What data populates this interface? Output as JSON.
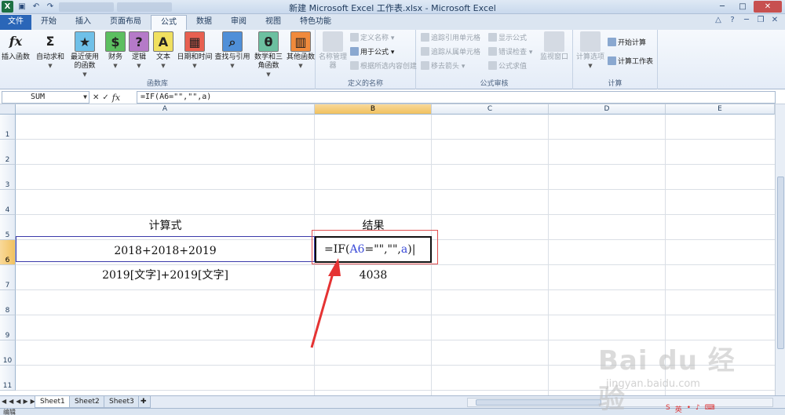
{
  "window": {
    "title": "新建 Microsoft Excel 工作表.xlsx - Microsoft Excel",
    "minimize": "─",
    "maximize": "□",
    "close": "✕"
  },
  "tabs": [
    "文件",
    "开始",
    "插入",
    "页面布局",
    "公式",
    "数据",
    "审阅",
    "视图",
    "特色功能"
  ],
  "active_tab": "公式",
  "ribbon": {
    "function_library": {
      "label": "函数库",
      "insert_function": "插入函数",
      "autosum": "自动求和",
      "recent": "最近使用的函数",
      "financial": "财务",
      "logical": "逻辑",
      "text": "文本",
      "datetime": "日期和时间",
      "lookup": "查找与引用",
      "math": "数学和三角函数",
      "more": "其他函数"
    },
    "defined_names": {
      "label": "定义的名称",
      "name_manager": "名称管理器",
      "define_name": "定义名称",
      "use_in_formula": "用于公式",
      "create_from_selection": "根据所选内容创建"
    },
    "formula_auditing": {
      "label": "公式审核",
      "trace_precedents": "追踪引用单元格",
      "trace_dependents": "追踪从属单元格",
      "remove_arrows": "移去箭头",
      "show_formulas": "显示公式",
      "error_checking": "错误检查",
      "evaluate_formula": "公式求值",
      "watch_window": "监视窗口"
    },
    "calculation": {
      "label": "计算",
      "calc_options": "计算选项",
      "calc_now": "开始计算",
      "calc_sheet": "计算工作表"
    }
  },
  "formula_bar": {
    "name_box": "SUM",
    "formula": "=IF(A6=\"\",\"\",a)"
  },
  "columns": [
    "A",
    "B",
    "C",
    "D",
    "E"
  ],
  "selected_column": "B",
  "rows": [
    "1",
    "2",
    "3",
    "4",
    "5",
    "6",
    "7",
    "8",
    "9",
    "10",
    "11"
  ],
  "selected_row": "6",
  "cells": {
    "A5": "计算式",
    "B5": "结果",
    "A6": "2018+2018+2019",
    "A7": "2019[文字]+2019[文字]",
    "B7": "4038"
  },
  "editing": {
    "prefix": "=IF(",
    "ref": "A6",
    "middle": "=\"\",\"\",",
    "arg": "a",
    "suffix": ")"
  },
  "sheets": [
    "Sheet1",
    "Sheet2",
    "Sheet3"
  ],
  "active_sheet": "Sheet1",
  "status": "编辑",
  "watermark": {
    "brand": "Bai du 经验",
    "url": "jingyan.baidu.com"
  },
  "accent_color": "#2a66b8",
  "arrow_color": "#e53333"
}
